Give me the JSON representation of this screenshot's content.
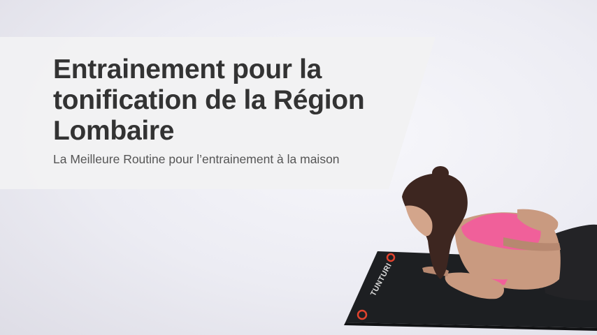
{
  "banner": {
    "title_lines": [
      "Entrainement pour la",
      "tonification de la Région",
      "Lombaire"
    ],
    "subtitle": "La Meilleure Routine pour l’entrainement à la maison"
  },
  "photo": {
    "mat_brand": "TUNTURI",
    "colors": {
      "banner": "#f1f1f3",
      "title": "#333333",
      "top": "#f0609a",
      "mat": "#1d1f22",
      "accent": "#e2432e"
    }
  }
}
